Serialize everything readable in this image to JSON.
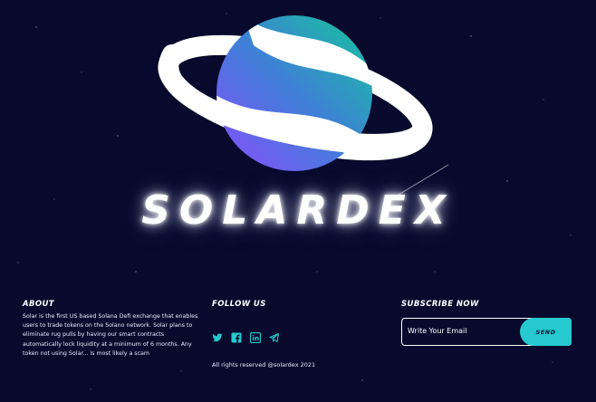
{
  "brand": {
    "name": "SOLARDEX"
  },
  "about": {
    "title": "About",
    "text": "Solar is the first US based Solana Defi exchange that enables users to trade tokens on the Solano network. Solar plans to eliminate rug pulls by having our smart contracts automatically lock liquidity at a minimum of 6 months. Any token not using Solar... is most likely a scam"
  },
  "follow": {
    "title": "Follow Us",
    "icons": [
      "twitter-icon",
      "facebook-icon",
      "linkedin-icon",
      "telegram-icon"
    ],
    "rights": "All rights reserved @solardex 2021"
  },
  "subscribe": {
    "title": "Subscribe Now",
    "placeholder": "Write Your Email",
    "button": "SEND"
  },
  "colors": {
    "background": "#070a2c",
    "accent": "#25c9cf",
    "planet_gradient": [
      "#8a4dff",
      "#3f7fd7",
      "#14c79a"
    ],
    "ring": "#ffffff"
  }
}
